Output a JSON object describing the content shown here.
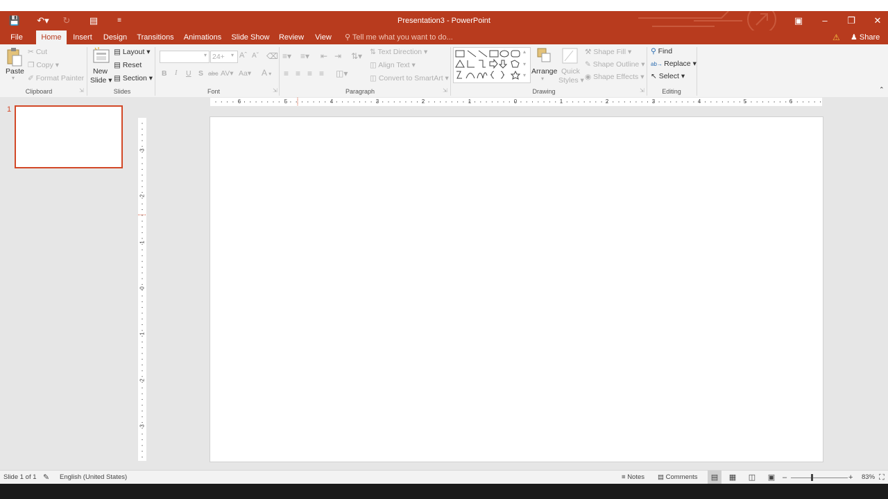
{
  "app": {
    "window_title": "Presentation3 - PowerPoint"
  },
  "tabs": [
    {
      "label": "File"
    },
    {
      "label": "Home"
    },
    {
      "label": "Insert"
    },
    {
      "label": "Design"
    },
    {
      "label": "Transitions"
    },
    {
      "label": "Animations"
    },
    {
      "label": "Slide Show"
    },
    {
      "label": "Review"
    },
    {
      "label": "View"
    }
  ],
  "tellme": {
    "placeholder": "Tell me what you want to do..."
  },
  "share": {
    "label": "Share"
  },
  "clipboard": {
    "group_label": "Clipboard",
    "paste": "Paste",
    "cut": "Cut",
    "copy": "Copy",
    "format_painter": "Format Painter"
  },
  "slides": {
    "group_label": "Slides",
    "new_slide_1": "New",
    "new_slide_2": "Slide",
    "layout": "Layout",
    "reset": "Reset",
    "section": "Section"
  },
  "font": {
    "group_label": "Font",
    "font_name": "",
    "font_size": "24+",
    "bold": "B",
    "italic": "I",
    "underline": "U",
    "shadow": "S",
    "strike": "abc",
    "spacing": "AV",
    "case": "Aa",
    "color": "A",
    "grow": "A",
    "shrink": "A"
  },
  "paragraph": {
    "group_label": "Paragraph",
    "text_direction": "Text Direction",
    "align_text": "Align Text",
    "convert_smartart": "Convert to SmartArt"
  },
  "drawing": {
    "group_label": "Drawing",
    "arrange": "Arrange",
    "quick_styles_1": "Quick",
    "quick_styles_2": "Styles",
    "shape_fill": "Shape Fill",
    "shape_outline": "Shape Outline",
    "shape_effects": "Shape Effects"
  },
  "editing": {
    "group_label": "Editing",
    "find": "Find",
    "replace": "Replace",
    "select": "Select"
  },
  "thumbs": {
    "slide_number": "1"
  },
  "hruler": {
    "labels": [
      "6",
      "5",
      "4",
      "3",
      "2",
      "1",
      "0",
      "1",
      "2",
      "3",
      "4",
      "5",
      "6"
    ]
  },
  "vruler": {
    "labels": [
      "3",
      "2",
      "1",
      "0",
      "1",
      "2",
      "3"
    ]
  },
  "status": {
    "slide_info": "Slide 1 of 1",
    "language": "English (United States)",
    "notes": "Notes",
    "comments": "Comments",
    "zoom": "83%"
  },
  "colors": {
    "accent": "#b83b1e",
    "ribbon": "#f3f3f3",
    "workspace": "#e6e6e6"
  }
}
